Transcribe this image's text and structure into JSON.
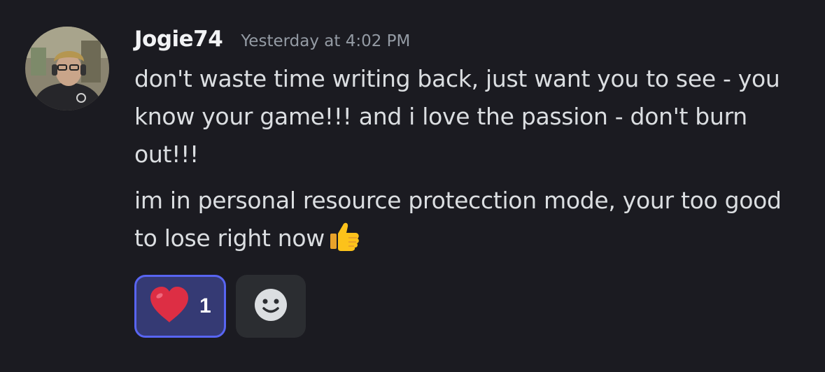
{
  "message": {
    "author": "Jogie74",
    "timestamp": "Yesterday at 4:02 PM",
    "paragraphs": [
      "don't waste time writing back, just want you to see - you know your game!!! and i love the passion - don't burn out!!!",
      "im in personal resource protecction mode, your too good to lose right now"
    ],
    "inline_emoji": "thumbs-up-icon"
  },
  "reactions": [
    {
      "emoji": "heart-icon",
      "count": "1",
      "active": true
    }
  ],
  "add_reaction_icon": "smiley-face-icon",
  "colors": {
    "background": "#1b1b21",
    "username": "#f2f3f5",
    "text": "#dbdee1",
    "timestamp": "#949ba4",
    "reaction_active_bg": "#353a74",
    "reaction_active_border": "#5865f2",
    "add_reaction_bg": "#2b2d31"
  }
}
